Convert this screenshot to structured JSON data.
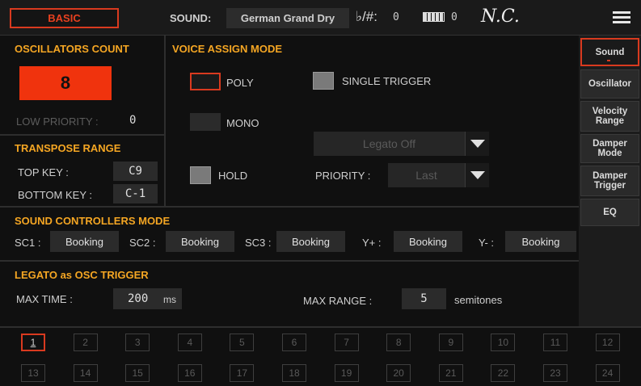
{
  "topbar": {
    "mode": "BASIC",
    "sound_label": "SOUND:",
    "sound_value": "German Grand Dry",
    "key_sig": "♭/#:",
    "key_value": "0",
    "octave_value": "0",
    "chord": "N.C."
  },
  "tabs": [
    {
      "label": "Sound",
      "active": true
    },
    {
      "label": "Oscillator",
      "active": false
    },
    {
      "label": "Velocity Range",
      "active": false
    },
    {
      "label": "Damper Mode",
      "active": false
    },
    {
      "label": "Damper Trigger",
      "active": false
    },
    {
      "label": "EQ",
      "active": false
    }
  ],
  "osc": {
    "title": "OSCILLATORS COUNT",
    "count": "8",
    "low_priority_label": "LOW PRIORITY :",
    "low_priority_value": "0"
  },
  "voice": {
    "title": "VOICE ASSIGN MODE",
    "poly": "POLY",
    "mono": "MONO",
    "hold": "HOLD",
    "single_trigger": "SINGLE TRIGGER",
    "legato": "Legato Off",
    "priority_label": "PRIORITY :",
    "priority_value": "Last"
  },
  "transpose": {
    "title": "TRANSPOSE RANGE",
    "top_label": "TOP KEY :",
    "top_value": "C9",
    "bottom_label": "BOTTOM KEY :",
    "bottom_value": "C-1"
  },
  "controllers": {
    "title": "SOUND CONTROLLERS MODE",
    "items": [
      {
        "label": "SC1 :",
        "value": "Booking"
      },
      {
        "label": "SC2 :",
        "value": "Booking"
      },
      {
        "label": "SC3 :",
        "value": "Booking"
      },
      {
        "label": "Y+ :",
        "value": "Booking"
      },
      {
        "label": "Y- :",
        "value": "Booking"
      }
    ]
  },
  "legato": {
    "title": "LEGATO as OSC TRIGGER",
    "max_time_label": "MAX TIME :",
    "max_time_value": "200",
    "max_time_unit": "ms",
    "max_range_label": "MAX RANGE :",
    "max_range_value": "5",
    "max_range_unit": "semitones"
  },
  "oscillators": [
    "1",
    "2",
    "3",
    "4",
    "5",
    "6",
    "7",
    "8",
    "9",
    "10",
    "11",
    "12",
    "13",
    "14",
    "15",
    "16",
    "17",
    "18",
    "19",
    "20",
    "21",
    "22",
    "23",
    "24"
  ],
  "active_oscillator": "1"
}
